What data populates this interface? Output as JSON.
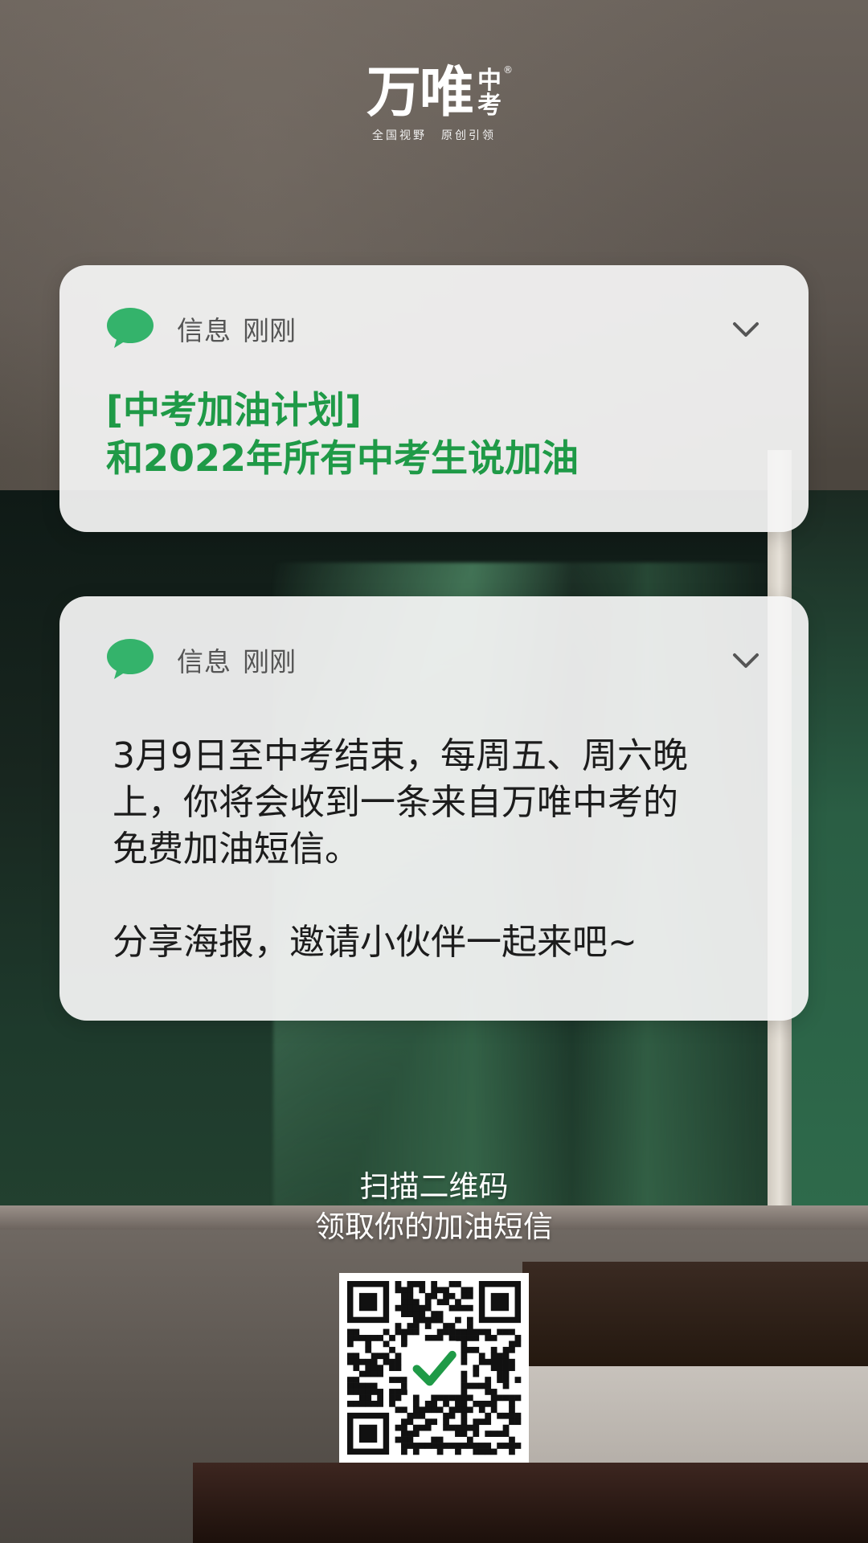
{
  "logo": {
    "main": "万唯",
    "side_top": "中",
    "side_bottom": "考",
    "reg": "®",
    "slogan_left": "全国视野",
    "slogan_right": "原创引领"
  },
  "notifications": [
    {
      "app": "信息",
      "time": "刚刚",
      "icon": "message-bubble-icon",
      "title_lines": [
        "[中考加油计划]",
        "和2022年所有中考生说加油"
      ]
    },
    {
      "app": "信息",
      "time": "刚刚",
      "icon": "message-bubble-icon",
      "body_lines": [
        "3月9日至中考结束，每周五、周六晚",
        "上，你将会收到一条来自万唯中考的",
        "免费加油短信。",
        "分享海报，邀请小伙伴一起来吧~"
      ]
    }
  ],
  "cta": {
    "line1": "扫描二维码",
    "line2": "领取你的加油短信"
  },
  "colors": {
    "accent_green": "#1f9a47",
    "icon_green": "#34b36b",
    "card_bg": "#f5f5f5"
  }
}
